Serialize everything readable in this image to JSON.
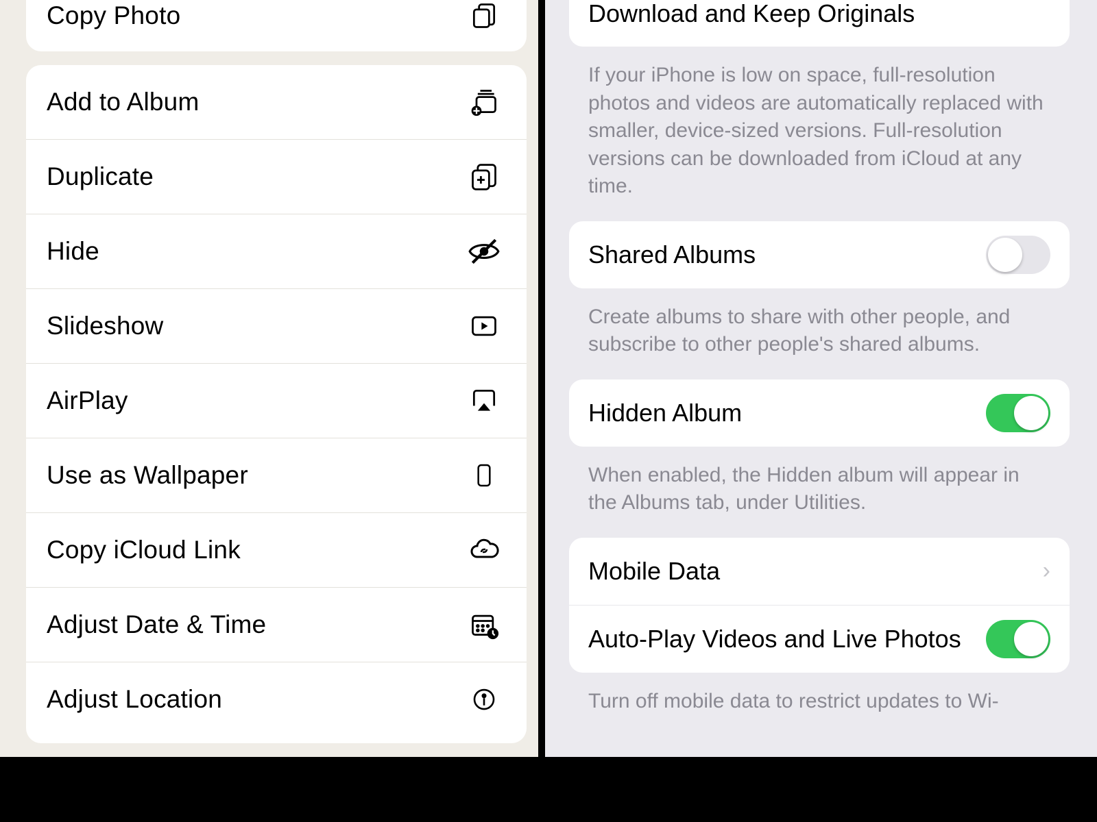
{
  "left_menu": {
    "top_item": {
      "label": "Copy Photo",
      "icon": "copy-icon"
    },
    "items": [
      {
        "label": "Add to Album",
        "icon": "add-to-album-icon"
      },
      {
        "label": "Duplicate",
        "icon": "duplicate-icon"
      },
      {
        "label": "Hide",
        "icon": "hide-icon"
      },
      {
        "label": "Slideshow",
        "icon": "slideshow-icon"
      },
      {
        "label": "AirPlay",
        "icon": "airplay-icon"
      },
      {
        "label": "Use as Wallpaper",
        "icon": "wallpaper-icon"
      },
      {
        "label": "Copy iCloud Link",
        "icon": "icloud-link-icon"
      },
      {
        "label": "Adjust Date & Time",
        "icon": "calendar-clock-icon"
      },
      {
        "label": "Adjust Location",
        "icon": "location-pin-icon"
      }
    ]
  },
  "right_settings": {
    "download": {
      "label": "Download and Keep Originals",
      "footer": "If your iPhone is low on space, full-resolution photos and videos are automatically replaced with smaller, device-sized versions. Full-resolution versions can be downloaded from iCloud at any time."
    },
    "shared": {
      "label": "Shared Albums",
      "enabled": false,
      "footer": "Create albums to share with other people, and subscribe to other people's shared albums."
    },
    "hidden": {
      "label": "Hidden Album",
      "enabled": true,
      "footer": "When enabled, the Hidden album will appear in the Albums tab, under Utilities."
    },
    "mobile_data": {
      "label": "Mobile Data"
    },
    "autoplay": {
      "label": "Auto-Play Videos and Live Photos",
      "enabled": true
    },
    "bottom_footer": "Turn off mobile data to restrict updates to Wi-"
  },
  "colors": {
    "toggle_on": "#34c759",
    "toggle_off": "#e6e5ea",
    "footer_text": "#8a8992"
  }
}
